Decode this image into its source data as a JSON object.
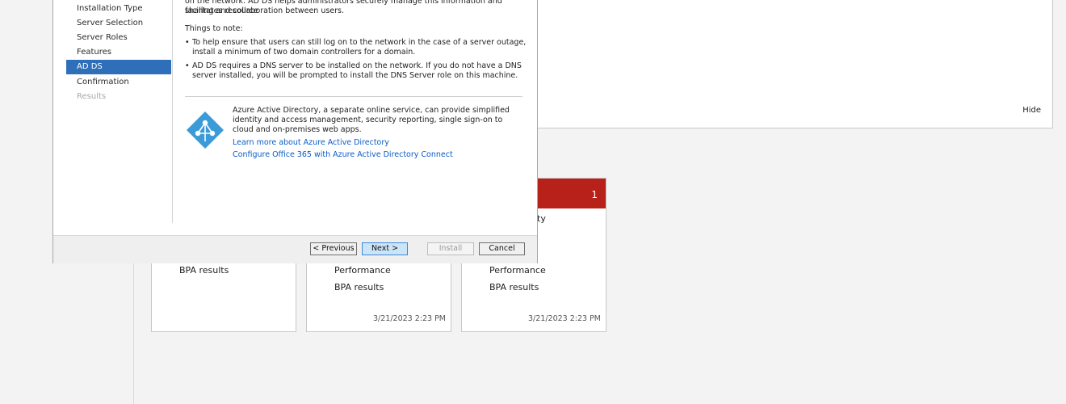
{
  "wizard": {
    "nav": {
      "items": [
        {
          "label": "Installation Type"
        },
        {
          "label": "Server Selection"
        },
        {
          "label": "Server Roles"
        },
        {
          "label": "Features"
        },
        {
          "label": "AD DS"
        },
        {
          "label": "Confirmation"
        },
        {
          "label": "Results"
        }
      ],
      "selected": "AD DS"
    },
    "content": {
      "intro_partial": "on the network. AD DS helps administrators securely manage this information and facilitates resource",
      "intro_line2": "sharing and collaboration between users.",
      "things_heading": "Things to note:",
      "bullets": [
        "To help ensure that users can still log on to the network in the case of a server outage, install a minimum of two domain controllers for a domain.",
        "AD DS requires a DNS server to be installed on the network. If you do not have a DNS server installed, you will be prompted to install the DNS Server role on this machine."
      ],
      "azure_text": "Azure Active Directory, a separate online service, can provide simplified identity and access management, security reporting, single sign-on to cloud and on-premises web apps.",
      "links": [
        "Learn more about Azure Active Directory",
        "Configure Office 365 with Azure Active Directory Connect"
      ]
    },
    "buttons": {
      "previous": "< Previous",
      "next": "Next >",
      "install": "Install",
      "cancel": "Cancel"
    }
  },
  "background": {
    "hide_label": "Hide",
    "tiles": [
      {
        "items": [
          "BPA results"
        ],
        "timestamp": ""
      },
      {
        "items": [
          "Performance",
          "BPA results"
        ],
        "timestamp": "3/21/2023 2:23 PM"
      },
      {
        "header_count": "1",
        "partial_label": "ty",
        "items": [
          "Performance",
          "BPA results"
        ],
        "timestamp": "3/21/2023 2:23 PM"
      }
    ]
  },
  "colors": {
    "accent": "#2f6fb9",
    "alert_red": "#b8211a",
    "link": "#0b5dc7",
    "azure_blue": "#3b9bd8"
  },
  "icons": [
    "azure-active-directory-icon"
  ]
}
